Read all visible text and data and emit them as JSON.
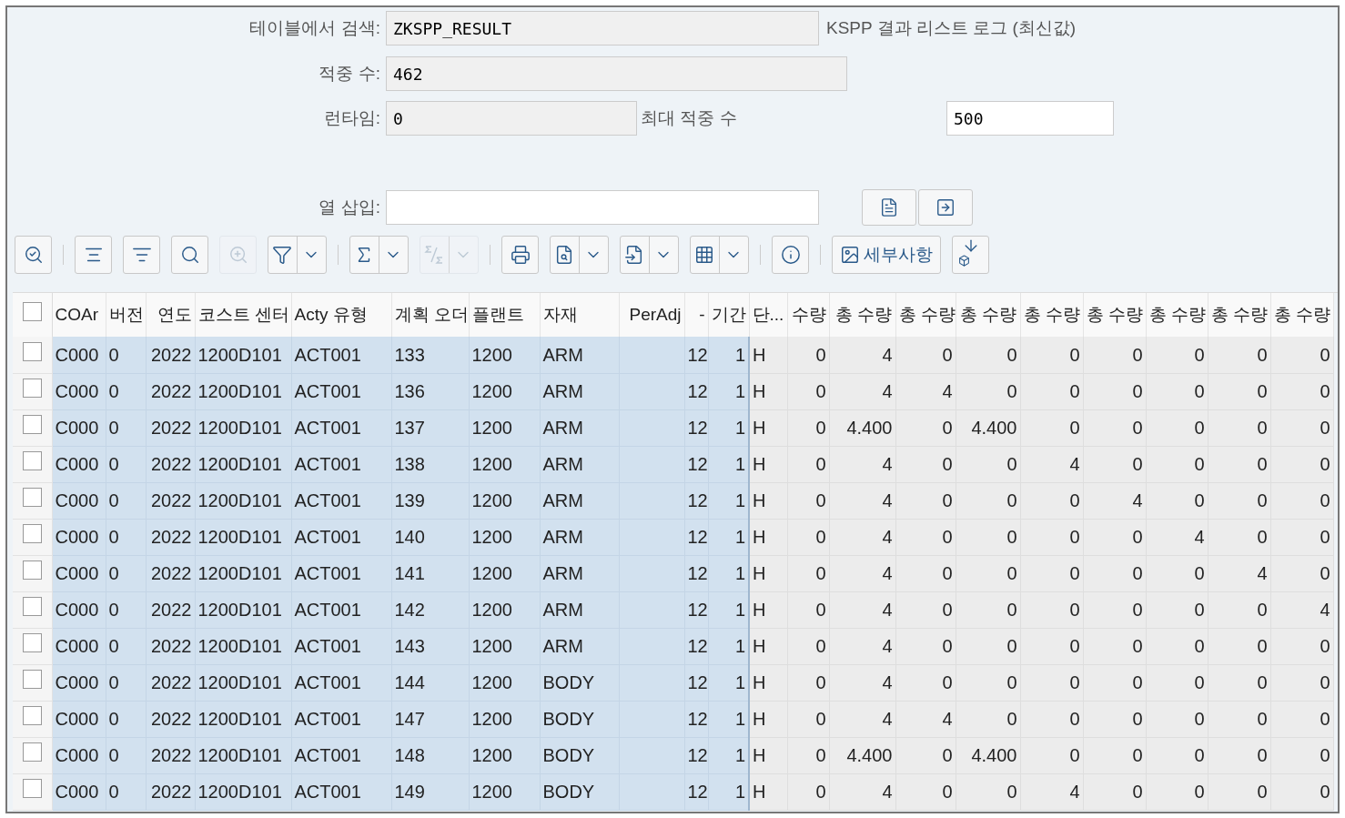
{
  "form": {
    "search_table": {
      "label": "테이블에서 검색:",
      "value": "ZKSPP_RESULT",
      "note": "KSPP 결과 리스트 로그 (최신값)"
    },
    "hits": {
      "label": "적중 수:",
      "value": "462"
    },
    "runtime": {
      "label": "런타임:",
      "value": "0"
    },
    "max_hits": {
      "label": "최대 적중 수",
      "value": "500"
    },
    "insert_column": {
      "label": "열 삽입:"
    }
  },
  "toolbar": [
    {
      "kind": "button",
      "disabled": false
    },
    {
      "kind": "separator"
    },
    {
      "kind": "button",
      "disabled": false
    },
    {
      "kind": "button",
      "disabled": false
    },
    {
      "kind": "button",
      "disabled": false
    },
    {
      "kind": "button",
      "disabled": true
    },
    {
      "kind": "split",
      "disabled": false
    },
    {
      "kind": "separator"
    },
    {
      "kind": "split",
      "disabled": false
    },
    {
      "kind": "split",
      "disabled": true
    },
    {
      "kind": "separator"
    },
    {
      "kind": "button",
      "disabled": false
    },
    {
      "kind": "split",
      "disabled": false
    },
    {
      "kind": "split",
      "disabled": false
    },
    {
      "kind": "split",
      "disabled": false
    },
    {
      "kind": "separator"
    },
    {
      "kind": "button",
      "disabled": false
    },
    {
      "kind": "separator"
    },
    {
      "kind": "text_button",
      "label": "세부사항",
      "disabled": false
    },
    {
      "kind": "button",
      "disabled": false
    }
  ],
  "table": {
    "header_checked": false,
    "columns": [
      {
        "label": "COAr",
        "key": true,
        "kind": "text"
      },
      {
        "label": "버전",
        "key": true,
        "kind": "text"
      },
      {
        "label": "연도",
        "key": true,
        "kind": "number"
      },
      {
        "label": "코스트 센터",
        "key": true,
        "kind": "text"
      },
      {
        "label": "Acty 유형",
        "key": true,
        "kind": "text"
      },
      {
        "label": "계획 오더",
        "key": true,
        "kind": "text"
      },
      {
        "label": "플랜트",
        "key": true,
        "kind": "text"
      },
      {
        "label": "자재",
        "key": true,
        "kind": "text"
      },
      {
        "label": "PerAdj",
        "key": true,
        "kind": "number"
      },
      {
        "label": "-",
        "key": true,
        "kind": "number"
      },
      {
        "label": "기간",
        "key": true,
        "kind": "number"
      },
      {
        "label": "단...",
        "key": false,
        "kind": "text"
      },
      {
        "label": "수량",
        "key": false,
        "kind": "number"
      },
      {
        "label": "총 수량",
        "key": false,
        "kind": "number"
      },
      {
        "label": "총 수량",
        "key": false,
        "kind": "number"
      },
      {
        "label": "총 수량",
        "key": false,
        "kind": "number"
      },
      {
        "label": "총 수량",
        "key": false,
        "kind": "number"
      },
      {
        "label": "총 수량",
        "key": false,
        "kind": "number"
      },
      {
        "label": "총 수량",
        "key": false,
        "kind": "number"
      },
      {
        "label": "총 수량",
        "key": false,
        "kind": "number"
      },
      {
        "label": "총 수량",
        "key": false,
        "kind": "number"
      }
    ],
    "rows": [
      {
        "checked": false,
        "cells": [
          "C000",
          "0",
          "2022",
          "1200D101",
          "ACT001",
          "133",
          "1200",
          "ARM",
          null,
          "12",
          "1",
          "H",
          "0",
          "4",
          "0",
          "0",
          "0",
          "0",
          "0",
          "0",
          "0"
        ]
      },
      {
        "checked": false,
        "cells": [
          "C000",
          "0",
          "2022",
          "1200D101",
          "ACT001",
          "136",
          "1200",
          "ARM",
          null,
          "12",
          "1",
          "H",
          "0",
          "4",
          "4",
          "0",
          "0",
          "0",
          "0",
          "0",
          "0"
        ]
      },
      {
        "checked": false,
        "cells": [
          "C000",
          "0",
          "2022",
          "1200D101",
          "ACT001",
          "137",
          "1200",
          "ARM",
          null,
          "12",
          "1",
          "H",
          "0",
          "4.400",
          "0",
          "4.400",
          "0",
          "0",
          "0",
          "0",
          "0"
        ]
      },
      {
        "checked": false,
        "cells": [
          "C000",
          "0",
          "2022",
          "1200D101",
          "ACT001",
          "138",
          "1200",
          "ARM",
          null,
          "12",
          "1",
          "H",
          "0",
          "4",
          "0",
          "0",
          "4",
          "0",
          "0",
          "0",
          "0"
        ]
      },
      {
        "checked": false,
        "cells": [
          "C000",
          "0",
          "2022",
          "1200D101",
          "ACT001",
          "139",
          "1200",
          "ARM",
          null,
          "12",
          "1",
          "H",
          "0",
          "4",
          "0",
          "0",
          "0",
          "4",
          "0",
          "0",
          "0"
        ]
      },
      {
        "checked": false,
        "cells": [
          "C000",
          "0",
          "2022",
          "1200D101",
          "ACT001",
          "140",
          "1200",
          "ARM",
          null,
          "12",
          "1",
          "H",
          "0",
          "4",
          "0",
          "0",
          "0",
          "0",
          "4",
          "0",
          "0"
        ]
      },
      {
        "checked": false,
        "cells": [
          "C000",
          "0",
          "2022",
          "1200D101",
          "ACT001",
          "141",
          "1200",
          "ARM",
          null,
          "12",
          "1",
          "H",
          "0",
          "4",
          "0",
          "0",
          "0",
          "0",
          "0",
          "4",
          "0"
        ]
      },
      {
        "checked": false,
        "cells": [
          "C000",
          "0",
          "2022",
          "1200D101",
          "ACT001",
          "142",
          "1200",
          "ARM",
          null,
          "12",
          "1",
          "H",
          "0",
          "4",
          "0",
          "0",
          "0",
          "0",
          "0",
          "0",
          "4"
        ]
      },
      {
        "checked": false,
        "cells": [
          "C000",
          "0",
          "2022",
          "1200D101",
          "ACT001",
          "143",
          "1200",
          "ARM",
          null,
          "12",
          "1",
          "H",
          "0",
          "4",
          "0",
          "0",
          "0",
          "0",
          "0",
          "0",
          "0"
        ]
      },
      {
        "checked": false,
        "cells": [
          "C000",
          "0",
          "2022",
          "1200D101",
          "ACT001",
          "144",
          "1200",
          "BODY",
          null,
          "12",
          "1",
          "H",
          "0",
          "4",
          "0",
          "0",
          "0",
          "0",
          "0",
          "0",
          "0"
        ]
      },
      {
        "checked": false,
        "cells": [
          "C000",
          "0",
          "2022",
          "1200D101",
          "ACT001",
          "147",
          "1200",
          "BODY",
          null,
          "12",
          "1",
          "H",
          "0",
          "4",
          "4",
          "0",
          "0",
          "0",
          "0",
          "0",
          "0"
        ]
      },
      {
        "checked": false,
        "cells": [
          "C000",
          "0",
          "2022",
          "1200D101",
          "ACT001",
          "148",
          "1200",
          "BODY",
          null,
          "12",
          "1",
          "H",
          "0",
          "4.400",
          "0",
          "4.400",
          "0",
          "0",
          "0",
          "0",
          "0"
        ]
      },
      {
        "checked": false,
        "cells": [
          "C000",
          "0",
          "2022",
          "1200D101",
          "ACT001",
          "149",
          "1200",
          "BODY",
          null,
          "12",
          "1",
          "H",
          "0",
          "4",
          "0",
          "0",
          "4",
          "0",
          "0",
          "0",
          "0"
        ]
      }
    ]
  }
}
